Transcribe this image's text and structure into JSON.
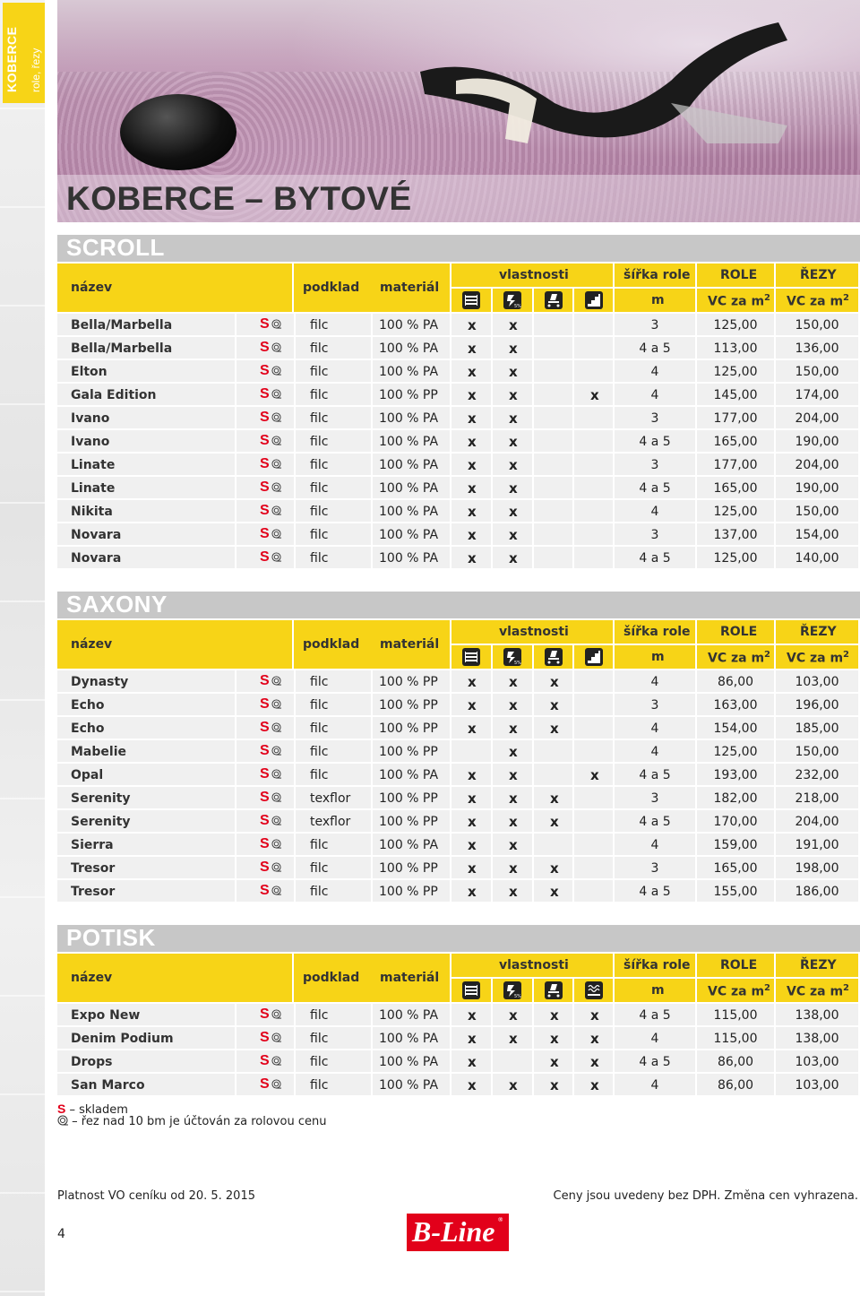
{
  "sidebar": {
    "title": "KOBERCE",
    "subtitle": "role, řezy"
  },
  "page_title": "KOBERCE – BYTOVÉ",
  "header": {
    "nazev": "název",
    "podklad": "podklad",
    "material": "materiál",
    "vlastnosti": "vlastnosti",
    "sirka": "šířka role",
    "sirka_unit": "m",
    "role": "ROLE",
    "role_unit": "VC za m",
    "rezy": "ŘEZY",
    "rezy_unit": "VC za m",
    "sup": "2"
  },
  "s_mark": "S",
  "sections": [
    {
      "title": "SCROLL",
      "icons": [
        "wear-icon",
        "antistatic-icon",
        "chair-castor-icon",
        "stairs-icon"
      ],
      "rows": [
        {
          "name": "Bella/Marbella",
          "podklad": "filc",
          "material": "100 % PA",
          "v": [
            "x",
            "x",
            "",
            ""
          ],
          "sirka": "3",
          "role": "125,00",
          "rezy": "150,00"
        },
        {
          "name": "Bella/Marbella",
          "podklad": "filc",
          "material": "100 % PA",
          "v": [
            "x",
            "x",
            "",
            ""
          ],
          "sirka": "4 a 5",
          "role": "113,00",
          "rezy": "136,00"
        },
        {
          "name": "Elton",
          "podklad": "filc",
          "material": "100 % PA",
          "v": [
            "x",
            "x",
            "",
            ""
          ],
          "sirka": "4",
          "role": "125,00",
          "rezy": "150,00"
        },
        {
          "name": "Gala Edition",
          "podklad": "filc",
          "material": "100 % PP",
          "v": [
            "x",
            "x",
            "",
            "x"
          ],
          "sirka": "4",
          "role": "145,00",
          "rezy": "174,00"
        },
        {
          "name": "Ivano",
          "podklad": "filc",
          "material": "100 % PA",
          "v": [
            "x",
            "x",
            "",
            ""
          ],
          "sirka": "3",
          "role": "177,00",
          "rezy": "204,00"
        },
        {
          "name": "Ivano",
          "podklad": "filc",
          "material": "100 % PA",
          "v": [
            "x",
            "x",
            "",
            ""
          ],
          "sirka": "4 a 5",
          "role": "165,00",
          "rezy": "190,00"
        },
        {
          "name": "Linate",
          "podklad": "filc",
          "material": "100 % PA",
          "v": [
            "x",
            "x",
            "",
            ""
          ],
          "sirka": "3",
          "role": "177,00",
          "rezy": "204,00"
        },
        {
          "name": "Linate",
          "podklad": "filc",
          "material": "100 % PA",
          "v": [
            "x",
            "x",
            "",
            ""
          ],
          "sirka": "4 a 5",
          "role": "165,00",
          "rezy": "190,00"
        },
        {
          "name": "Nikita",
          "podklad": "filc",
          "material": "100 % PA",
          "v": [
            "x",
            "x",
            "",
            ""
          ],
          "sirka": "4",
          "role": "125,00",
          "rezy": "150,00"
        },
        {
          "name": "Novara",
          "podklad": "filc",
          "material": "100 % PA",
          "v": [
            "x",
            "x",
            "",
            ""
          ],
          "sirka": "3",
          "role": "137,00",
          "rezy": "154,00"
        },
        {
          "name": "Novara",
          "podklad": "filc",
          "material": "100 % PA",
          "v": [
            "x",
            "x",
            "",
            ""
          ],
          "sirka": "4 a 5",
          "role": "125,00",
          "rezy": "140,00"
        }
      ]
    },
    {
      "title": "SAXONY",
      "icons": [
        "wear-icon",
        "antistatic-icon",
        "chair-castor-icon",
        "stairs-icon"
      ],
      "rows": [
        {
          "name": "Dynasty",
          "podklad": "filc",
          "material": "100 % PP",
          "v": [
            "x",
            "x",
            "x",
            ""
          ],
          "sirka": "4",
          "role": "86,00",
          "rezy": "103,00"
        },
        {
          "name": "Echo",
          "podklad": "filc",
          "material": "100 % PP",
          "v": [
            "x",
            "x",
            "x",
            ""
          ],
          "sirka": "3",
          "role": "163,00",
          "rezy": "196,00"
        },
        {
          "name": "Echo",
          "podklad": "filc",
          "material": "100 % PP",
          "v": [
            "x",
            "x",
            "x",
            ""
          ],
          "sirka": "4",
          "role": "154,00",
          "rezy": "185,00"
        },
        {
          "name": "Mabelie",
          "podklad": "filc",
          "material": "100 % PP",
          "v": [
            "",
            "x",
            "",
            ""
          ],
          "sirka": "4",
          "role": "125,00",
          "rezy": "150,00"
        },
        {
          "name": "Opal",
          "podklad": "filc",
          "material": "100 % PA",
          "v": [
            "x",
            "x",
            "",
            "x"
          ],
          "sirka": "4 a 5",
          "role": "193,00",
          "rezy": "232,00"
        },
        {
          "name": "Serenity",
          "podklad": "texflor",
          "material": "100 % PP",
          "v": [
            "x",
            "x",
            "x",
            ""
          ],
          "sirka": "3",
          "role": "182,00",
          "rezy": "218,00"
        },
        {
          "name": "Serenity",
          "podklad": "texflor",
          "material": "100 % PP",
          "v": [
            "x",
            "x",
            "x",
            ""
          ],
          "sirka": "4 a 5",
          "role": "170,00",
          "rezy": "204,00"
        },
        {
          "name": "Sierra",
          "podklad": "filc",
          "material": "100 % PA",
          "v": [
            "x",
            "x",
            "",
            ""
          ],
          "sirka": "4",
          "role": "159,00",
          "rezy": "191,00"
        },
        {
          "name": "Tresor",
          "podklad": "filc",
          "material": "100 % PP",
          "v": [
            "x",
            "x",
            "x",
            ""
          ],
          "sirka": "3",
          "role": "165,00",
          "rezy": "198,00"
        },
        {
          "name": "Tresor",
          "podklad": "filc",
          "material": "100 % PP",
          "v": [
            "x",
            "x",
            "x",
            ""
          ],
          "sirka": "4 a 5",
          "role": "155,00",
          "rezy": "186,00"
        }
      ]
    },
    {
      "title": "POTISK",
      "icons": [
        "wear-icon",
        "antistatic-icon",
        "chair-castor-icon",
        "underfloor-heating-icon"
      ],
      "rows": [
        {
          "name": "Expo New",
          "podklad": "filc",
          "material": "100 % PA",
          "v": [
            "x",
            "x",
            "x",
            "x"
          ],
          "sirka": "4 a 5",
          "role": "115,00",
          "rezy": "138,00"
        },
        {
          "name": "Denim Podium",
          "podklad": "filc",
          "material": "100 % PA",
          "v": [
            "x",
            "x",
            "x",
            "x"
          ],
          "sirka": "4",
          "role": "115,00",
          "rezy": "138,00"
        },
        {
          "name": "Drops",
          "podklad": "filc",
          "material": "100 % PA",
          "v": [
            "x",
            "",
            "x",
            "x"
          ],
          "sirka": "4 a 5",
          "role": "86,00",
          "rezy": "103,00"
        },
        {
          "name": "San Marco",
          "podklad": "filc",
          "material": "100 % PA",
          "v": [
            "x",
            "x",
            "x",
            "x"
          ],
          "sirka": "4",
          "role": "86,00",
          "rezy": "103,00"
        }
      ]
    }
  ],
  "legend": {
    "s_text": "– skladem",
    "roll_text": "– řez nad 10 bm je účtován za rolovou cenu"
  },
  "footer": {
    "left": "Platnost VO ceníku od 20. 5. 2015",
    "right": "Ceny jsou uvedeny bez DPH. Změna cen vyhrazena.",
    "page": "4"
  },
  "logo": {
    "text": "B-Line",
    "mark": "®"
  },
  "colors": {
    "yellow": "#f7d417",
    "red": "#e2001a",
    "grey_band": "#c7c7c7",
    "row_bg": "#f0f0f0"
  }
}
